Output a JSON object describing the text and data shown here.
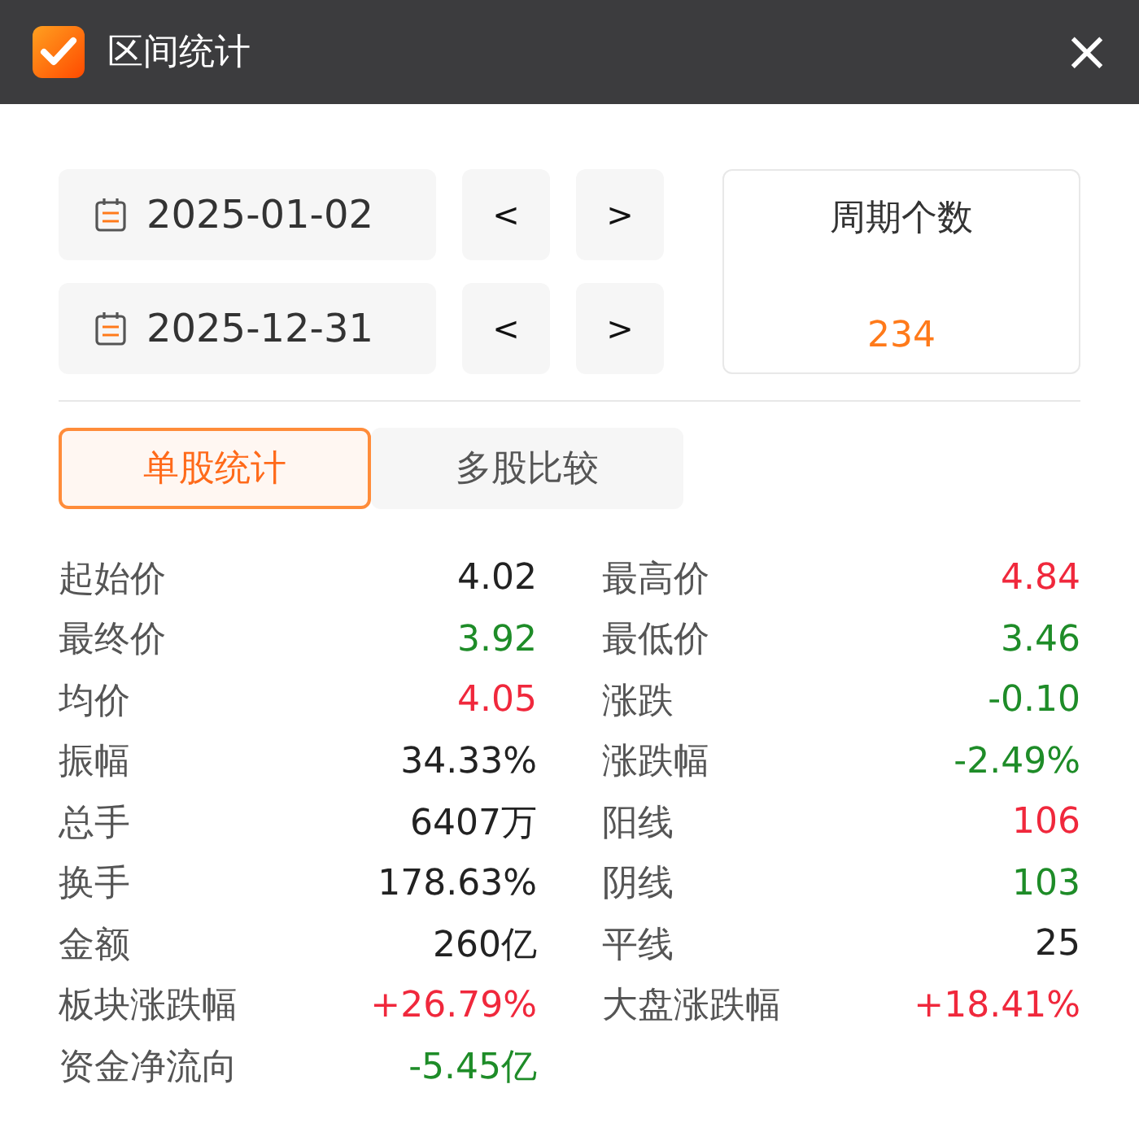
{
  "window": {
    "title": "区间统计",
    "close": "×"
  },
  "range": [
    {
      "date": "2025-01-02",
      "prev": "<",
      "next": ">"
    },
    {
      "date": "2025-12-31",
      "prev": "<",
      "next": ">"
    }
  ],
  "period_count": {
    "label": "周期个数",
    "value": "234"
  },
  "tabs": [
    {
      "label": "单股统计",
      "selected": true
    },
    {
      "label": "多股比较",
      "selected": false
    }
  ],
  "stats": [
    {
      "label": "起始价",
      "value": "4.02",
      "color": "#222222"
    },
    {
      "label": "最高价",
      "value": "4.84",
      "color": "#f0283c"
    },
    {
      "label": "最终价",
      "value": "3.92",
      "color": "#1e8c28"
    },
    {
      "label": "最低价",
      "value": "3.46",
      "color": "#1e8c28"
    },
    {
      "label": "均价",
      "value": "4.05",
      "color": "#f0283c"
    },
    {
      "label": "涨跌",
      "value": "-0.10",
      "color": "#1e8c28"
    },
    {
      "label": "振幅",
      "value": "34.33%",
      "color": "#222222"
    },
    {
      "label": "涨跌幅",
      "value": "-2.49%",
      "color": "#1e8c28"
    },
    {
      "label": "总手",
      "value": "6407万",
      "color": "#222222"
    },
    {
      "label": "阳线",
      "value": "106",
      "color": "#f0283c"
    },
    {
      "label": "换手",
      "value": "178.63%",
      "color": "#222222"
    },
    {
      "label": "阴线",
      "value": "103",
      "color": "#1e8c28"
    },
    {
      "label": "金额",
      "value": "260亿",
      "color": "#222222"
    },
    {
      "label": "平线",
      "value": "25",
      "color": "#222222"
    },
    {
      "label": "板块涨跌幅",
      "value": "+26.79%",
      "color": "#f0283c"
    },
    {
      "label": "大盘涨跌幅",
      "value": "+18.41%",
      "color": "#f0283c"
    },
    {
      "label": "资金净流向",
      "value": "-5.45亿",
      "color": "#1e8c28"
    }
  ]
}
